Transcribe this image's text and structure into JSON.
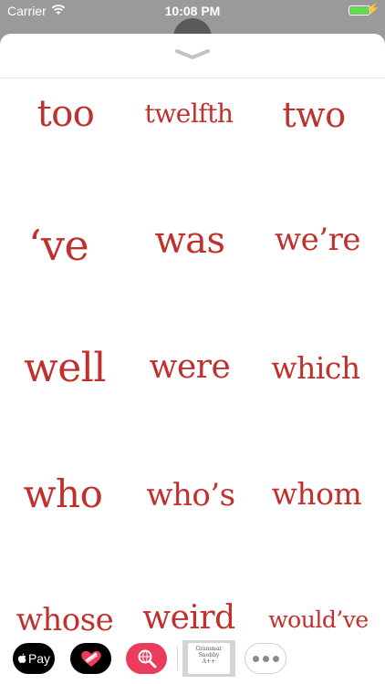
{
  "status_bar": {
    "carrier": "Carrier",
    "time": "10:08 PM",
    "battery_color": "#5be14a"
  },
  "sticker_color": "#c0302c",
  "stickers": [
    {
      "word": "too"
    },
    {
      "word": "twelfth"
    },
    {
      "word": "two"
    },
    {
      "word": "‘ve"
    },
    {
      "word": "was"
    },
    {
      "word": "we’re"
    },
    {
      "word": "well"
    },
    {
      "word": "were"
    },
    {
      "word": "which"
    },
    {
      "word": "who"
    },
    {
      "word": "who’s"
    },
    {
      "word": "whom"
    },
    {
      "word": "whose"
    },
    {
      "word": "weird"
    },
    {
      "word": "would’ve"
    }
  ],
  "app_drawer": {
    "apple_pay_label": "Pay",
    "sticker_pack_label_line1": "Grammar",
    "sticker_pack_label_line2": "Snobby",
    "sticker_pack_label_line3": "A++",
    "icons": [
      "apple-pay-icon",
      "digital-touch-icon",
      "search-globe-icon",
      "grammar-sticker-pack-icon",
      "more-icon"
    ]
  }
}
